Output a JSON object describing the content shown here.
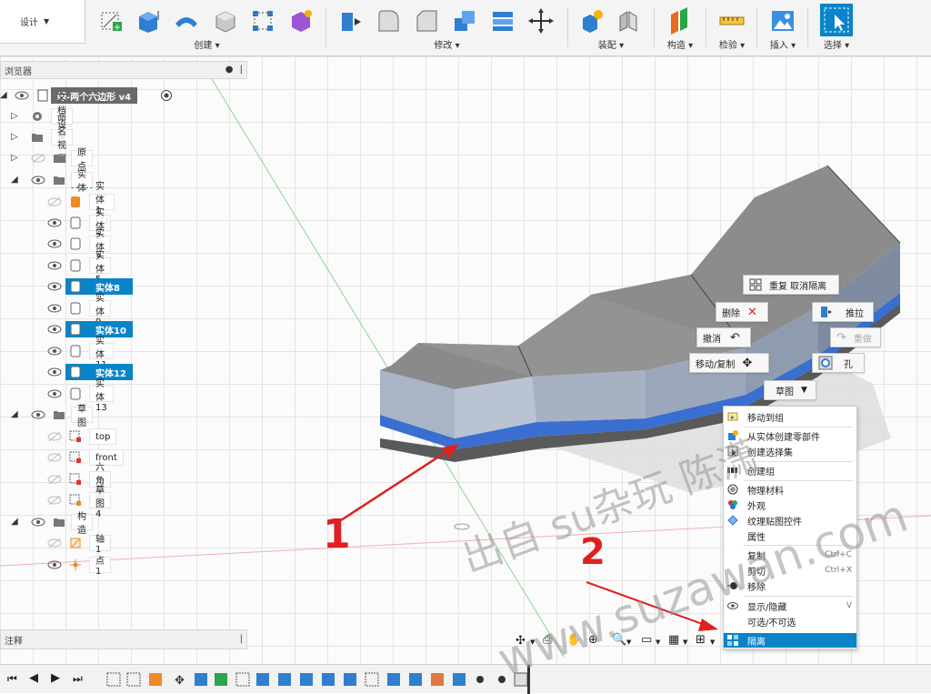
{
  "toolbar": {
    "design_label": "设计",
    "groups": {
      "create": "创建",
      "modify": "修改",
      "assemble": "装配",
      "construct": "构造",
      "inspect": "检验",
      "insert": "插入",
      "select": "选择"
    }
  },
  "browser": {
    "title": "浏览器",
    "root": "绿-两个六边形 v4",
    "items": {
      "doc_settings": "文档设置",
      "named_views": "命名视图",
      "origin": "原点",
      "bodies": "实体",
      "sketches": "草图",
      "construction": "构造"
    },
    "bodies": [
      "实体1 (1)",
      "实体2",
      "实体3",
      "实体5",
      "实体8",
      "实体9",
      "实体10",
      "实体11",
      "实体12",
      "实体13"
    ],
    "sketches": [
      "top",
      "front",
      "六角面",
      "草图4"
    ],
    "construction": [
      "轴1",
      "点1"
    ]
  },
  "notes": {
    "title": "注释"
  },
  "marking_menu": {
    "repeat": "重复 取消隔离",
    "delete": "删除",
    "press_pull": "推拉",
    "undo": "撤消",
    "redo": "重做",
    "move_copy": "移动/复制",
    "hole": "孔",
    "sketch": "草图"
  },
  "context_menu": {
    "move_to_group": "移动到组",
    "create_component": "从实体创建零部件",
    "create_selection_set": "创建选择集",
    "create_group": "创建组",
    "physical_material": "物理材料",
    "appearance": "外观",
    "texture_map": "纹理贴图控件",
    "properties": "属性",
    "copy": "复制",
    "copy_shortcut": "Ctrl+C",
    "cut": "剪切",
    "cut_shortcut": "Ctrl+X",
    "remove": "移除",
    "show_hide": "显示/隐藏",
    "show_hide_shortcut": "V",
    "selectable": "可选/不可选",
    "isolate": "隔离"
  },
  "annotations": {
    "label_1": "1",
    "label_2": "2",
    "watermark_cn": "出自 su杂玩 陈潇",
    "watermark_url": "www.suzawan.com"
  },
  "colors": {
    "accent": "#0a84c8",
    "arrow": "#e02020",
    "body_top": "#8e8e8e",
    "body_stripe": "#3a6fd1"
  }
}
